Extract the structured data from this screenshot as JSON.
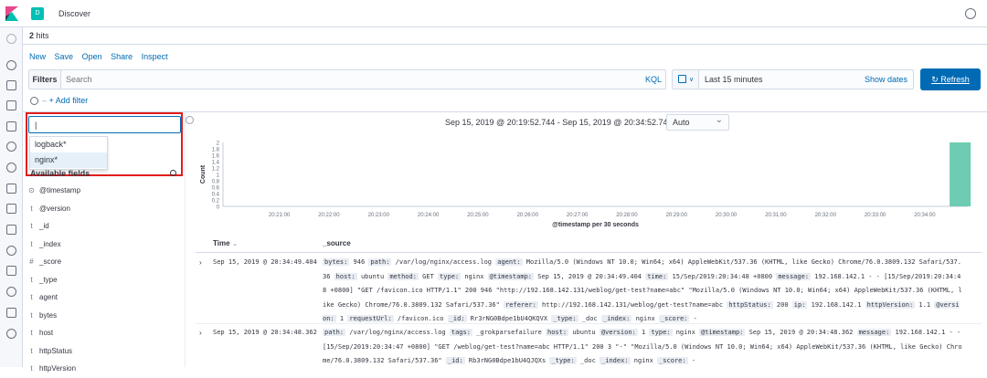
{
  "header": {
    "title": "Discover",
    "app_badge": "D"
  },
  "hits": {
    "count": "2",
    "label": " hits"
  },
  "menu": {
    "new": "New",
    "save": "Save",
    "open": "Open",
    "share": "Share",
    "inspect": "Inspect"
  },
  "query": {
    "filters_label": "Filters",
    "placeholder": "Search",
    "kql": "KQL"
  },
  "date": {
    "range": "Last 15 minutes",
    "show_dates": "Show dates",
    "refresh": "Refresh"
  },
  "filter_bar": {
    "add_filter": "+ Add filter",
    "separator": "–"
  },
  "index_pattern": {
    "value": "|",
    "options": [
      "logback*",
      "nginx*"
    ],
    "highlighted": 1
  },
  "sidebar": {
    "available_label": "Available fields",
    "fields": [
      {
        "type": "⊙",
        "name": "@timestamp"
      },
      {
        "type": "t",
        "name": "@version"
      },
      {
        "type": "t",
        "name": "_id"
      },
      {
        "type": "t",
        "name": "_index"
      },
      {
        "type": "#",
        "name": "_score"
      },
      {
        "type": "t",
        "name": "_type"
      },
      {
        "type": "t",
        "name": "agent"
      },
      {
        "type": "t",
        "name": "bytes"
      },
      {
        "type": "t",
        "name": "host"
      },
      {
        "type": "t",
        "name": "httpStatus"
      },
      {
        "type": "t",
        "name": "httpVersion"
      }
    ]
  },
  "histogram": {
    "time_range": "Sep 15, 2019 @ 20:19:52.744 - Sep 15, 2019 @ 20:34:52.744 —",
    "interval": "Auto"
  },
  "chart_data": {
    "type": "bar",
    "ylabel": "Count",
    "xlabel": "@timestamp per 30 seconds",
    "x_ticks": [
      "20:21:00",
      "20:22:00",
      "20:23:00",
      "20:24:00",
      "20:25:00",
      "20:26:00",
      "20:27:00",
      "20:28:00",
      "20:29:00",
      "20:30:00",
      "20:31:00",
      "20:32:00",
      "20:33:00",
      "20:34:00"
    ],
    "y_ticks": [
      0,
      0.2,
      0.4,
      0.6,
      0.8,
      1,
      1.2,
      1.4,
      1.6,
      1.8,
      2
    ],
    "ylim": [
      0,
      2
    ],
    "bars": [
      {
        "x": "20:34:30",
        "value": 2
      }
    ],
    "bar_color": "#6dccb1",
    "grid": false
  },
  "table": {
    "time_header": "Time",
    "time_sort_icon": "⌄",
    "source_header": "_source",
    "rows": [
      {
        "time": "Sep 15, 2019 @ 20:34:49.404",
        "source": [
          [
            "bytes:",
            " 946 "
          ],
          [
            "path:",
            " /var/log/nginx/access.log "
          ],
          [
            "agent:",
            " Mozilla/5.0 (Windows NT 10.0; Win64; x64) AppleWebKit/537.36 (KHTML, like Gecko) Chrome/76.0.3809.132 Safari/537.36 "
          ],
          [
            "host:",
            " ubuntu "
          ],
          [
            "method:",
            " GET "
          ],
          [
            "type:",
            " nginx "
          ],
          [
            "@timestamp:",
            " Sep 15, 2019 @ 20:34:49.404 "
          ],
          [
            "time:",
            " 15/Sep/2019:20:34:48 +0800 "
          ],
          [
            "message:",
            " 192.168.142.1 - - [15/Sep/2019:20:34:48 +0800] \"GET /favicon.ico HTTP/1.1\" 200 946 \"http://192.168.142.131/weblog/get-test?name=abc\" \"Mozilla/5.0 (Windows NT 10.0; Win64; x64) AppleWebKit/537.36 (KHTML, like Gecko) Chrome/76.0.3809.132 Safari/537.36\" "
          ],
          [
            "referer:",
            " http://192.168.142.131/weblog/get-test?name=abc "
          ],
          [
            "httpStatus:",
            " 200 "
          ],
          [
            "ip:",
            " 192.168.142.1 "
          ],
          [
            "httpVersion:",
            " 1.1 "
          ],
          [
            "@version:",
            " 1 "
          ],
          [
            "requestUrl:",
            " /favicon.ico "
          ],
          [
            "_id:",
            " Rr3rNG0Bdpe1bU4QKQVX "
          ],
          [
            "_type:",
            " _doc "
          ],
          [
            "_index:",
            " nginx "
          ],
          [
            "_score:",
            " - "
          ]
        ]
      },
      {
        "time": "Sep 15, 2019 @ 20:34:48.362",
        "source": [
          [
            "path:",
            " /var/log/nginx/access.log "
          ],
          [
            "tags:",
            " _grokparsefailure "
          ],
          [
            "host:",
            " ubuntu "
          ],
          [
            "@version:",
            " 1 "
          ],
          [
            "type:",
            " nginx "
          ],
          [
            "@timestamp:",
            " Sep 15, 2019 @ 20:34:48.362 "
          ],
          [
            "message:",
            " 192.168.142.1 - - [15/Sep/2019:20:34:47 +0800] \"GET /weblog/get-test?name=abc HTTP/1.1\" 200 3 \"-\" \"Mozilla/5.0 (Windows NT 10.0; Win64; x64) AppleWebKit/537.36 (KHTML, like Gecko) Chrome/76.0.3809.132 Safari/537.36\" "
          ],
          [
            "_id:",
            " Rb3rNG0Bdpe1bU4QJQXs "
          ],
          [
            "_type:",
            " _doc "
          ],
          [
            "_index:",
            " nginx "
          ],
          [
            "_score:",
            " - "
          ]
        ]
      }
    ]
  },
  "colors": {
    "accent": "#006bb4",
    "highlight_box": "#e21d1d",
    "bar": "#6dccb1"
  },
  "icons": [
    "kibana-logo-icon",
    "help-icon",
    "clock-icon",
    "discover-icon",
    "visualize-icon",
    "dashboard-icon",
    "canvas-icon",
    "maps-icon",
    "ml-icon",
    "infra-icon",
    "logs-icon",
    "apm-icon",
    "uptime-icon",
    "siem-icon",
    "dev-tools-icon",
    "monitoring-icon",
    "management-icon",
    "settings-gear-icon",
    "calendar-icon",
    "refresh-icon"
  ]
}
